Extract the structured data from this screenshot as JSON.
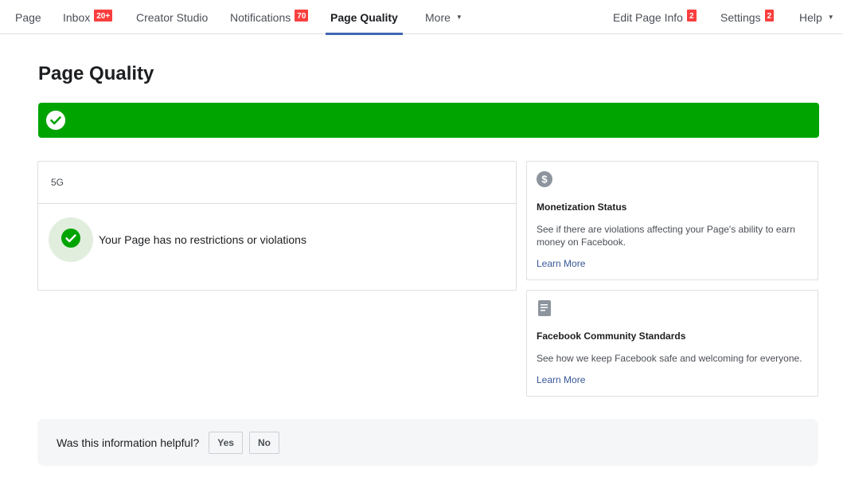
{
  "nav": {
    "page": "Page",
    "inbox": "Inbox",
    "inbox_badge": "20+",
    "creator_studio": "Creator Studio",
    "notifications": "Notifications",
    "notifications_badge": "70",
    "page_quality": "Page Quality",
    "more": "More",
    "edit_page_info": "Edit Page Info",
    "edit_page_info_badge": "2",
    "settings": "Settings",
    "settings_badge": "2",
    "help": "Help"
  },
  "title": "Page Quality",
  "status": {
    "header": "5G",
    "message": "Your Page has no restrictions or violations"
  },
  "monetization": {
    "icon": "dollar-icon",
    "title": "Monetization Status",
    "description": "See if there are violations affecting your Page's ability to earn money on Facebook.",
    "link": "Learn More"
  },
  "community": {
    "icon": "document-icon",
    "title": "Facebook Community Standards",
    "description": "See how we keep Facebook safe and welcoming for everyone.",
    "link": "Learn More"
  },
  "feedback": {
    "question": "Was this information helpful?",
    "yes": "Yes",
    "no": "No"
  },
  "colors": {
    "success": "#00a400",
    "badge": "#fa3e3e",
    "accent": "#4267b2",
    "link": "#385898"
  }
}
